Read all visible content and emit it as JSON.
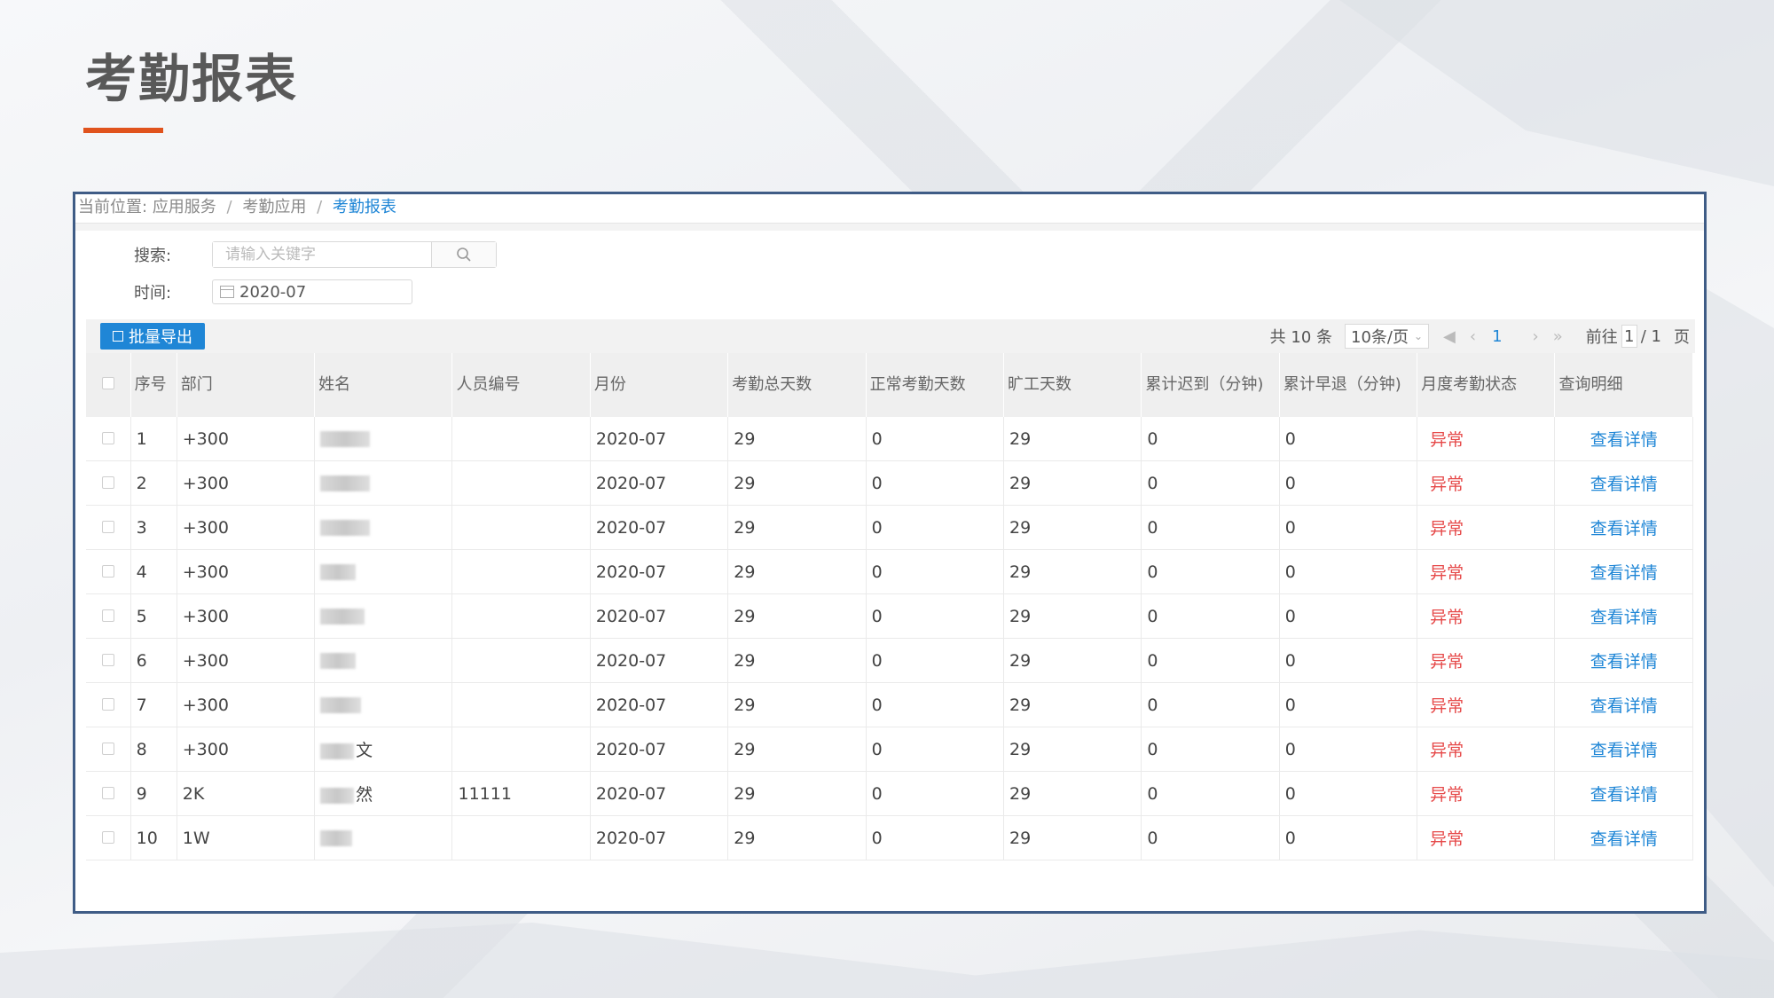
{
  "slide": {
    "title": "考勤报表"
  },
  "breadcrumb": {
    "prefix": "当前位置:",
    "items": [
      "应用服务",
      "考勤应用",
      "考勤报表"
    ]
  },
  "filters": {
    "search_label": "搜索:",
    "search_placeholder": "请输入关键字",
    "time_label": "时间:",
    "time_value": "2020-07"
  },
  "toolbar": {
    "export_label": "批量导出"
  },
  "pager": {
    "total": "共 10 条",
    "page_size": "10条/页",
    "current_page": "1",
    "goto_label": "前往",
    "goto_value": "1",
    "total_pages": "/ 1",
    "page_unit": "页"
  },
  "table": {
    "headers": [
      "序号",
      "部门",
      "姓名",
      "人员编号",
      "月份",
      "考勤总天数",
      "正常考勤天数",
      "旷工天数",
      "累计迟到（分钟)",
      "累计早退（分钟)",
      "月度考勤状态",
      "查询明细"
    ],
    "rows": [
      {
        "no": "1",
        "dept": "+300",
        "name": "",
        "emp_id": "",
        "month": "2020-07",
        "total": "29",
        "normal": "0",
        "absent": "29",
        "late": "0",
        "early": "0",
        "status": "异常",
        "detail": "查看详情"
      },
      {
        "no": "2",
        "dept": "+300",
        "name": "",
        "emp_id": "",
        "month": "2020-07",
        "total": "29",
        "normal": "0",
        "absent": "29",
        "late": "0",
        "early": "0",
        "status": "异常",
        "detail": "查看详情"
      },
      {
        "no": "3",
        "dept": "+300",
        "name": "",
        "emp_id": "",
        "month": "2020-07",
        "total": "29",
        "normal": "0",
        "absent": "29",
        "late": "0",
        "early": "0",
        "status": "异常",
        "detail": "查看详情"
      },
      {
        "no": "4",
        "dept": "+300",
        "name": "",
        "emp_id": "",
        "month": "2020-07",
        "total": "29",
        "normal": "0",
        "absent": "29",
        "late": "0",
        "early": "0",
        "status": "异常",
        "detail": "查看详情"
      },
      {
        "no": "5",
        "dept": "+300",
        "name": "",
        "emp_id": "",
        "month": "2020-07",
        "total": "29",
        "normal": "0",
        "absent": "29",
        "late": "0",
        "early": "0",
        "status": "异常",
        "detail": "查看详情"
      },
      {
        "no": "6",
        "dept": "+300",
        "name": "",
        "emp_id": "",
        "month": "2020-07",
        "total": "29",
        "normal": "0",
        "absent": "29",
        "late": "0",
        "early": "0",
        "status": "异常",
        "detail": "查看详情"
      },
      {
        "no": "7",
        "dept": "+300",
        "name": "",
        "emp_id": "",
        "month": "2020-07",
        "total": "29",
        "normal": "0",
        "absent": "29",
        "late": "0",
        "early": "0",
        "status": "异常",
        "detail": "查看详情"
      },
      {
        "no": "8",
        "dept": "+300",
        "name": "文",
        "emp_id": "",
        "month": "2020-07",
        "total": "29",
        "normal": "0",
        "absent": "29",
        "late": "0",
        "early": "0",
        "status": "异常",
        "detail": "查看详情"
      },
      {
        "no": "9",
        "dept": "2K",
        "name": "然",
        "emp_id": "11111",
        "month": "2020-07",
        "total": "29",
        "normal": "0",
        "absent": "29",
        "late": "0",
        "early": "0",
        "status": "异常",
        "detail": "查看详情"
      },
      {
        "no": "10",
        "dept": "1W",
        "name": "",
        "emp_id": "",
        "month": "2020-07",
        "total": "29",
        "normal": "0",
        "absent": "29",
        "late": "0",
        "early": "0",
        "status": "异常",
        "detail": "查看详情"
      }
    ]
  },
  "colors": {
    "accent": "#1f86d6",
    "title_underline": "#e0531d",
    "frame_border": "#3f5c86",
    "status_abnormal": "#e64a4a"
  },
  "icons": {
    "search": "search-icon",
    "calendar": "calendar-icon",
    "export": "export-icon"
  }
}
